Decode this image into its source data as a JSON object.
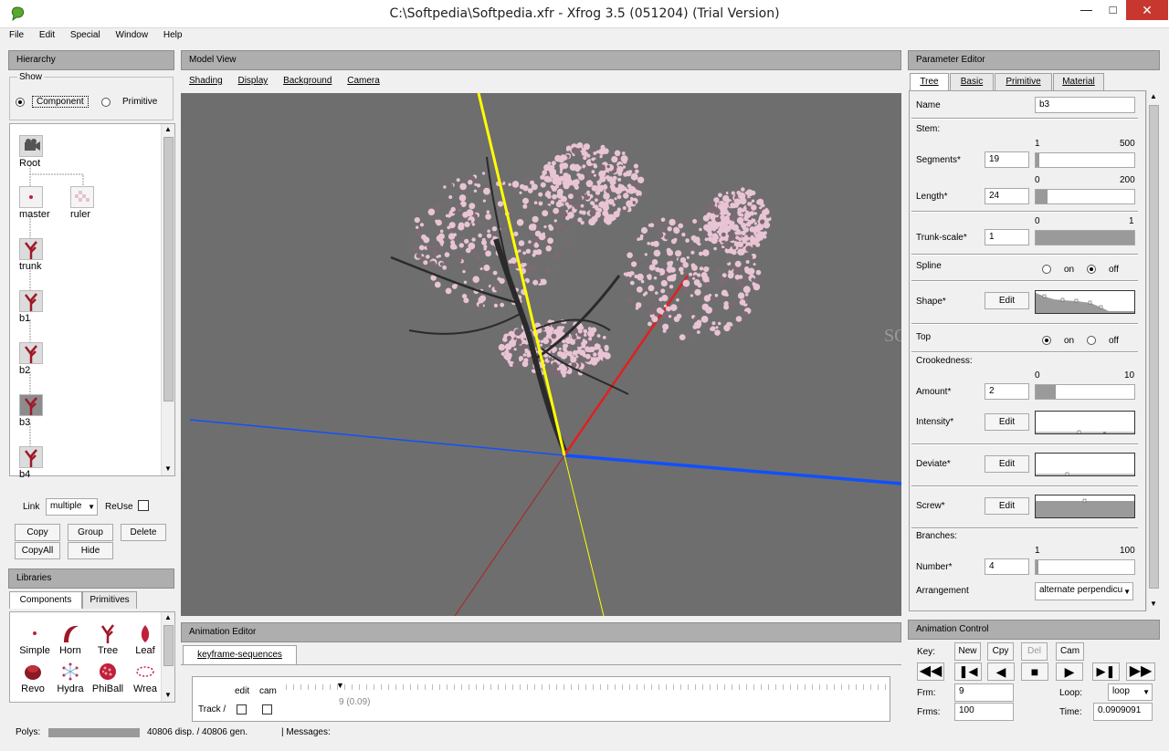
{
  "window": {
    "title": "C:\\Softpedia\\Softpedia.xfr - Xfrog 3.5 (051204) (Trial Version)"
  },
  "menu": [
    "File",
    "Edit",
    "Special",
    "Window",
    "Help"
  ],
  "hierarchy": {
    "header": "Hierarchy",
    "show_label": "Show",
    "opt_component": "Component",
    "opt_primitive": "Primitive",
    "nodes": {
      "root": "Root",
      "master": "master",
      "ruler": "ruler",
      "trunk": "trunk",
      "b1": "b1",
      "b2": "b2",
      "b3": "b3",
      "b4": "b4"
    },
    "link_label": "Link",
    "link_value": "multiple",
    "reuse_label": "ReUse",
    "btn_copy": "Copy",
    "btn_group": "Group",
    "btn_delete": "Delete",
    "btn_copyall": "CopyAll",
    "btn_hide": "Hide"
  },
  "libraries": {
    "header": "Libraries",
    "tab_components": "Components",
    "tab_primitives": "Primitives",
    "items": [
      "Simple",
      "Horn",
      "Tree",
      "Leaf",
      "Revo",
      "Hydra",
      "PhiBall",
      "Wrea"
    ]
  },
  "model_view": {
    "header": "Model View",
    "menu": [
      "Shading",
      "Display",
      "Background",
      "Camera"
    ],
    "watermark": "SOFTPEDIA"
  },
  "animation_editor": {
    "header": "Animation Editor",
    "tab": "keyframe-sequences",
    "col_edit": "edit",
    "col_cam": "cam",
    "track_label": "Track /",
    "marker": "9 (0.09)"
  },
  "param_editor": {
    "header": "Parameter Editor",
    "tabs": [
      "Tree",
      "Basic",
      "Primitive",
      "Material"
    ],
    "name_label": "Name",
    "name_value": "b3",
    "stem_label": "Stem:",
    "segments": {
      "label": "Segments*",
      "value": "19",
      "min": "1",
      "max": "500",
      "fraction": 0.036
    },
    "length": {
      "label": "Length*",
      "value": "24",
      "min": "0",
      "max": "200",
      "fraction": 0.12
    },
    "trunk_scale": {
      "label": "Trunk-scale*",
      "value": "1",
      "min": "0",
      "max": "1",
      "fraction": 1.0
    },
    "spline": {
      "label": "Spline",
      "on": "on",
      "off": "off",
      "selected": "off"
    },
    "shape": {
      "label": "Shape*",
      "btn": "Edit"
    },
    "top": {
      "label": "Top",
      "on": "on",
      "off": "off",
      "selected": "on"
    },
    "crookedness_label": "Crookedness:",
    "amount": {
      "label": "Amount*",
      "value": "2",
      "min": "0",
      "max": "10",
      "fraction": 0.2
    },
    "intensity": {
      "label": "Intensity*",
      "btn": "Edit"
    },
    "deviate": {
      "label": "Deviate*",
      "btn": "Edit"
    },
    "screw": {
      "label": "Screw*",
      "btn": "Edit"
    },
    "branches_label": "Branches:",
    "number": {
      "label": "Number*",
      "value": "4",
      "min": "1",
      "max": "100",
      "fraction": 0.03
    },
    "arrangement": {
      "label": "Arrangement",
      "value": "alternate perpendicu"
    }
  },
  "animation_control": {
    "header": "Animation Control",
    "key_label": "Key:",
    "btn_new": "New",
    "btn_cpy": "Cpy",
    "btn_del": "Del",
    "btn_cam": "Cam",
    "frm_label": "Frm:",
    "frm_value": "9",
    "frms_label": "Frms:",
    "frms_value": "100",
    "loop_label": "Loop:",
    "loop_value": "loop",
    "time_label": "Time:",
    "time_value": "0.0909091"
  },
  "status": {
    "polys_label": "Polys:",
    "polys_value": "40806 disp. / 40806 gen.",
    "messages_label": "| Messages:"
  },
  "colors": {
    "viewport_bg": "#6e6e6e",
    "axis_yellow": "#ffff00",
    "axis_red": "#e02020",
    "axis_blue": "#1050ff",
    "blossom": "#e8c4d4"
  }
}
